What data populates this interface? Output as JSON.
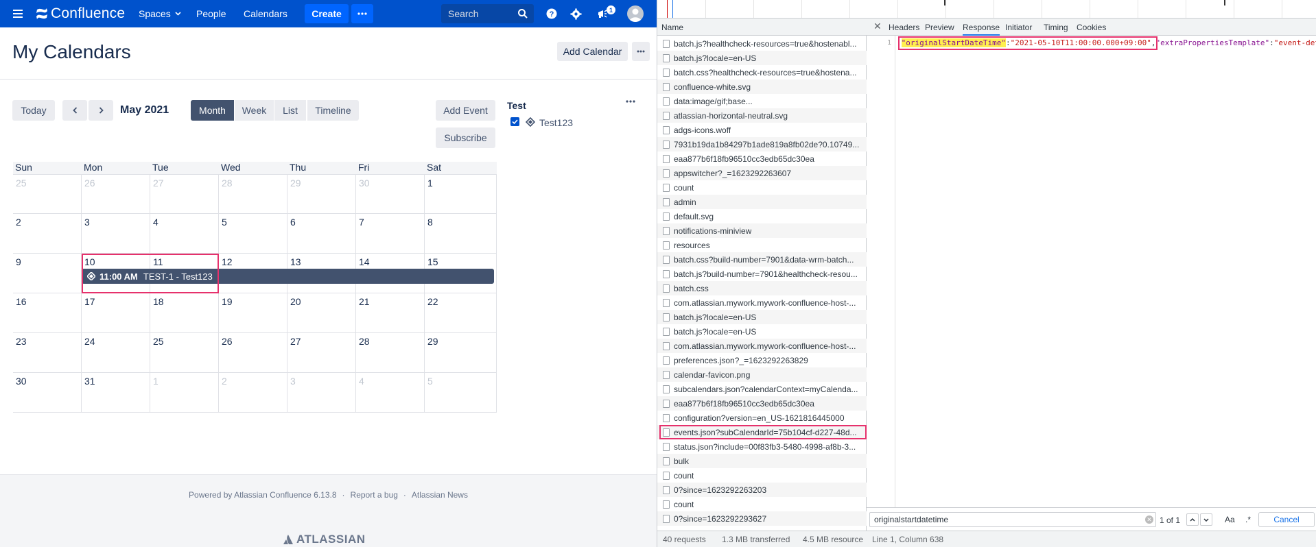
{
  "confluence": {
    "nav": {
      "logo_text": "Confluence",
      "spaces": "Spaces",
      "people": "People",
      "calendars": "Calendars",
      "create": "Create",
      "search_placeholder": "Search",
      "notification_count": "1"
    },
    "page_title": "My Calendars",
    "add_calendar": "Add Calendar",
    "toolbar": {
      "today": "Today",
      "month_label": "May 2021",
      "views": [
        "Month",
        "Week",
        "List",
        "Timeline"
      ],
      "active_view": "Month",
      "add_event": "Add Event",
      "subscribe": "Subscribe"
    },
    "weekdays": [
      "Sun",
      "Mon",
      "Tue",
      "Wed",
      "Thu",
      "Fri",
      "Sat"
    ],
    "weeks": [
      [
        {
          "d": "25",
          "o": true
        },
        {
          "d": "26",
          "o": true
        },
        {
          "d": "27",
          "o": true
        },
        {
          "d": "28",
          "o": true
        },
        {
          "d": "29",
          "o": true
        },
        {
          "d": "30",
          "o": true
        },
        {
          "d": "1",
          "o": false
        }
      ],
      [
        {
          "d": "2",
          "o": false
        },
        {
          "d": "3",
          "o": false
        },
        {
          "d": "4",
          "o": false
        },
        {
          "d": "5",
          "o": false
        },
        {
          "d": "6",
          "o": false
        },
        {
          "d": "7",
          "o": false
        },
        {
          "d": "8",
          "o": false
        }
      ],
      [
        {
          "d": "9",
          "o": false
        },
        {
          "d": "10",
          "o": false
        },
        {
          "d": "11",
          "o": false
        },
        {
          "d": "12",
          "o": false
        },
        {
          "d": "13",
          "o": false
        },
        {
          "d": "14",
          "o": false
        },
        {
          "d": "15",
          "o": false
        }
      ],
      [
        {
          "d": "16",
          "o": false
        },
        {
          "d": "17",
          "o": false
        },
        {
          "d": "18",
          "o": false
        },
        {
          "d": "19",
          "o": false
        },
        {
          "d": "20",
          "o": false
        },
        {
          "d": "21",
          "o": false
        },
        {
          "d": "22",
          "o": false
        }
      ],
      [
        {
          "d": "23",
          "o": false
        },
        {
          "d": "24",
          "o": false
        },
        {
          "d": "25",
          "o": false
        },
        {
          "d": "26",
          "o": false
        },
        {
          "d": "27",
          "o": false
        },
        {
          "d": "28",
          "o": false
        },
        {
          "d": "29",
          "o": false
        }
      ],
      [
        {
          "d": "30",
          "o": false
        },
        {
          "d": "31",
          "o": false
        },
        {
          "d": "1",
          "o": true
        },
        {
          "d": "2",
          "o": true
        },
        {
          "d": "3",
          "o": true
        },
        {
          "d": "4",
          "o": true
        },
        {
          "d": "5",
          "o": true
        }
      ]
    ],
    "event": {
      "time": "11:00 AM",
      "title": "TEST-1 - Test123"
    },
    "sidebar": {
      "group_title": "Test",
      "calendar_name": "Test123",
      "checked": true
    },
    "footer": {
      "powered_by": "Powered by Atlassian Confluence 6.13.8",
      "report_bug": "Report a bug",
      "news": "Atlassian News",
      "separator": "·",
      "brand": "ATLASSIAN"
    }
  },
  "devtools": {
    "name_header": "Name",
    "requests": [
      "batch.js?healthcheck-resources=true&hostenabl...",
      "batch.js?locale=en-US",
      "batch.css?healthcheck-resources=true&hostena...",
      "confluence-white.svg",
      "data:image/gif;base...",
      "atlassian-horizontal-neutral.svg",
      "adgs-icons.woff",
      "7931b19da1b84297b1ade819a8fb02de?0.10749...",
      "eaa877b6f18fb96510cc3edb65dc30ea",
      "appswitcher?_=1623292263607",
      "count",
      "admin",
      "default.svg",
      "notifications-miniview",
      "resources",
      "batch.css?build-number=7901&data-wrm-batch...",
      "batch.js?build-number=7901&healthcheck-resou...",
      "batch.css",
      "com.atlassian.mywork.mywork-confluence-host-...",
      "batch.js?locale=en-US",
      "batch.js?locale=en-US",
      "com.atlassian.mywork.mywork-confluence-host-...",
      "preferences.json?_=1623292263829",
      "calendar-favicon.png",
      "subcalendars.json?calendarContext=myCalenda...",
      "eaa877b6f18fb96510cc3edb65dc30ea",
      "configuration?version=en_US-1621816445000",
      "events.json?subCalendarId=75b104cf-d227-48d...",
      "status.json?include=00f83fb3-5480-4998-af8b-3...",
      "bulk",
      "count",
      "0?since=1623292263203",
      "count",
      "0?since=1623292293627"
    ],
    "selected_index": 27,
    "tabs": [
      "Headers",
      "Preview",
      "Response",
      "Initiator",
      "Timing",
      "Cookies"
    ],
    "active_tab": "Response",
    "response": {
      "line_number": "1",
      "prefix": ",",
      "key": "\"originalStartDateTime\"",
      "colon": ":",
      "value": "\"2021-05-10T11:00:00.000+09:00\"",
      "comma": ",",
      "key2": "\"extraPropertiesTemplate\"",
      "colon2": ":",
      "value2": "\"event-det"
    },
    "find": {
      "query": "originalstartdatetime",
      "count": "1 of 1",
      "case_label": "Aa",
      "regex_label": ".*",
      "cancel": "Cancel"
    },
    "status": {
      "requests": "40 requests",
      "transferred": "1.3 MB transferred",
      "resources": "4.5 MB resource",
      "cursor": "Line 1, Column 638"
    }
  }
}
